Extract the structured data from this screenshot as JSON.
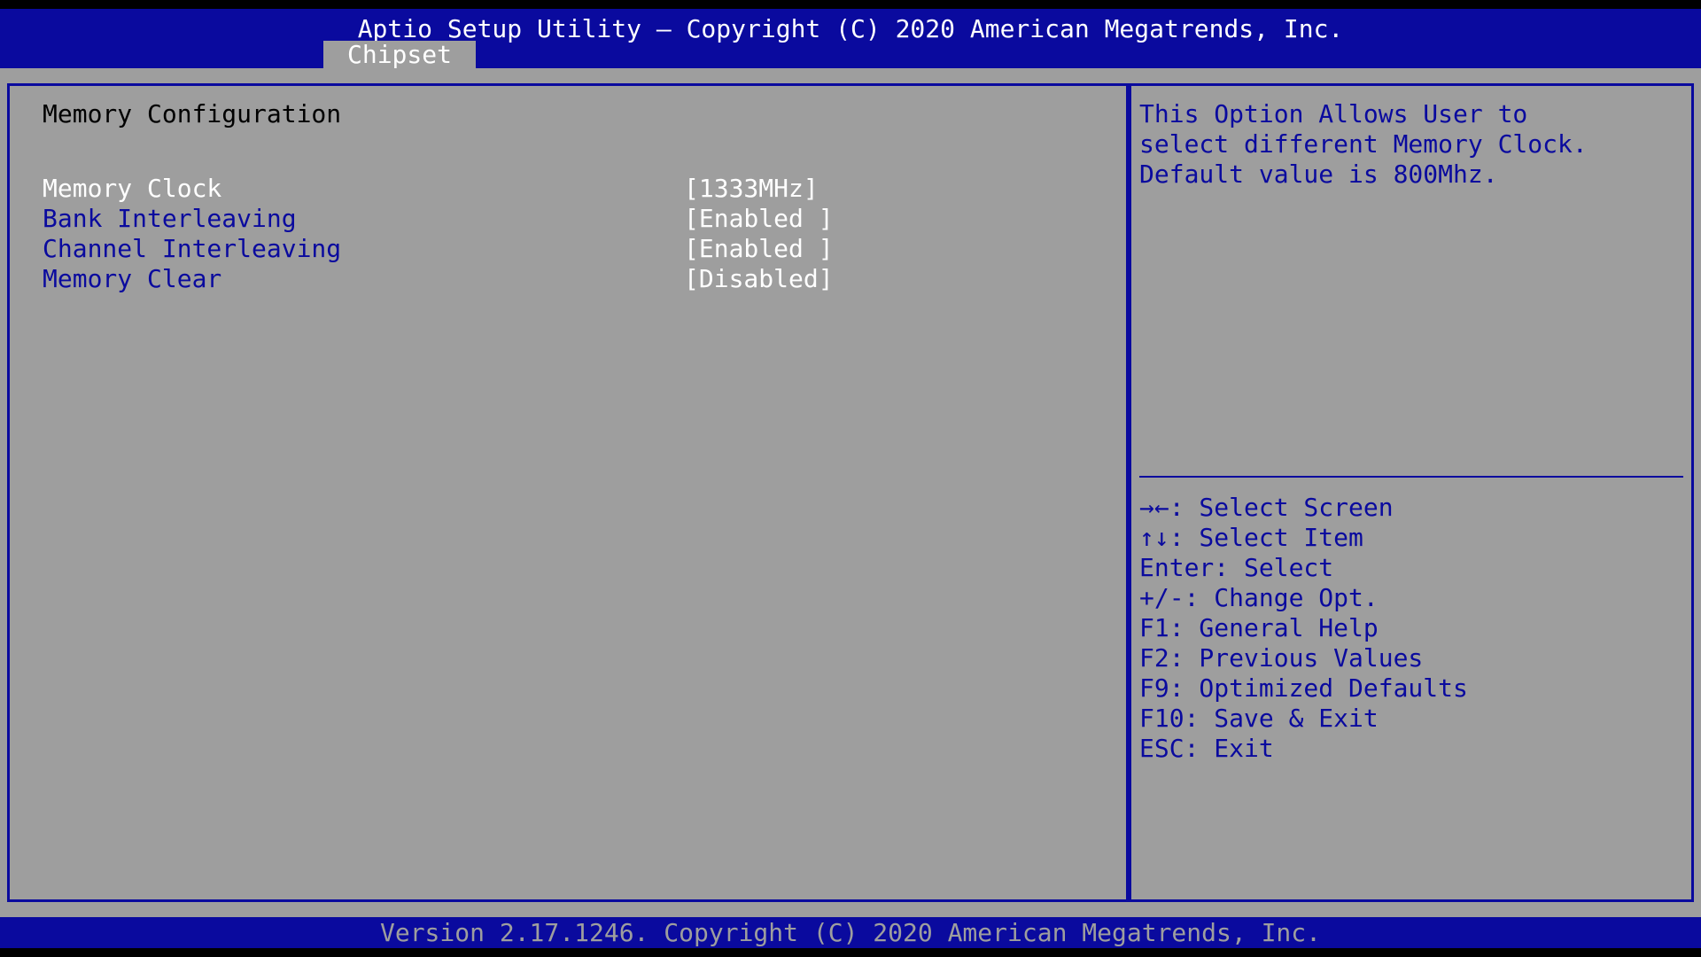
{
  "header": {
    "title": "Aptio Setup Utility – Copyright (C) 2020 American Megatrends, Inc.",
    "active_tab": "Chipset"
  },
  "main": {
    "section_title": "Memory Configuration",
    "options": [
      {
        "label": "Memory Clock",
        "value": "[1333MHz]",
        "selected": true
      },
      {
        "label": "Bank Interleaving",
        "value": "[Enabled ]",
        "selected": false
      },
      {
        "label": "Channel Interleaving",
        "value": "[Enabled ]",
        "selected": false
      },
      {
        "label": "Memory Clear",
        "value": "[Disabled]",
        "selected": false
      }
    ]
  },
  "help": {
    "description": [
      "This Option Allows User to",
      "select different Memory Clock.",
      "Default value is 800Mhz."
    ],
    "keys": [
      "→←: Select Screen",
      "↑↓: Select Item",
      "Enter: Select",
      "+/-: Change Opt.",
      "F1: General Help",
      "F2: Previous Values",
      "F9: Optimized Defaults",
      "F10: Save & Exit",
      "ESC: Exit"
    ]
  },
  "footer": {
    "version": "Version 2.17.1246. Copyright (C) 2020 American Megatrends, Inc."
  },
  "colors": {
    "blue": "#0a0a9e",
    "gray": "#9e9e9e",
    "white": "#ffffff",
    "black": "#000000"
  }
}
